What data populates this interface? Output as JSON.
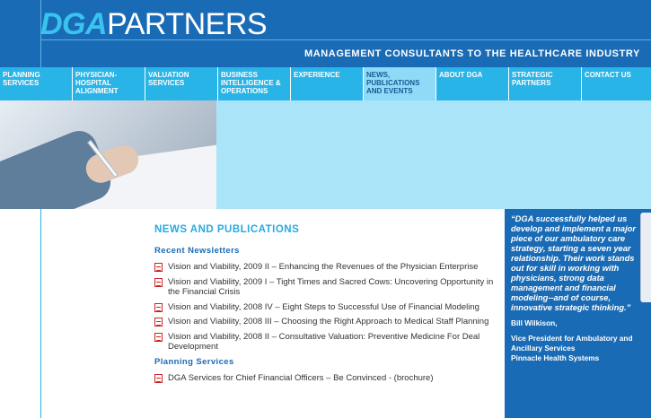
{
  "header": {
    "logo_dga": "DGA",
    "logo_partners": "PARTNERS",
    "tagline": "MANAGEMENT CONSULTANTS TO THE HEALTHCARE INDUSTRY"
  },
  "nav": {
    "items": [
      {
        "label": "PLANNING SERVICES"
      },
      {
        "label": "PHYSICIAN-HOSPITAL ALIGNMENT"
      },
      {
        "label": "VALUATION SERVICES"
      },
      {
        "label": "BUSINESS INTELLIGENCE & OPERATIONS"
      },
      {
        "label": "EXPERIENCE"
      },
      {
        "label": "NEWS, PUBLICATIONS AND EVENTS"
      },
      {
        "label": "ABOUT DGA"
      },
      {
        "label": "STRATEGIC PARTNERS"
      },
      {
        "label": "CONTACT US"
      }
    ]
  },
  "main": {
    "title": "NEWS AND PUBLICATIONS",
    "sections": [
      {
        "title": "Recent Newsletters",
        "items": [
          {
            "text": "Vision and Viability, 2009 II – Enhancing the Revenues of the Physician Enterprise"
          },
          {
            "text": "Vision and Viability, 2009 I – Tight Times and Sacred Cows: Uncovering Opportunity in the Financial Crisis"
          },
          {
            "text": "Vision and Viability, 2008 IV – Eight Steps to Successful Use of Financial Modeling"
          },
          {
            "text": "Vision and Viability, 2008 III – Choosing the Right Approach to Medical Staff Planning"
          },
          {
            "text": "Vision and Viability, 2008 II – Consultative Valuation: Preventive Medicine For Deal Development"
          }
        ]
      },
      {
        "title": "Planning Services",
        "items": [
          {
            "text": "DGA Services for Chief Financial Officers – Be Convinced - (brochure)"
          }
        ]
      }
    ]
  },
  "quote": {
    "text": "“DGA successfully helped us develop and implement a major piece of our ambulatory care strategy, starting a seven year relationship. Their work stands out for skill in working with physicians, strong data management and financial modeling--and of course, innovative strategic thinking.”",
    "name": "Bill Wilkison,",
    "role": "Vice President for Ambulatory and Ancillary Services",
    "org": "Pinnacle Health Systems"
  },
  "icons": {
    "pdf": "pdf-icon"
  },
  "colors": {
    "brand_blue": "#1a6bb5",
    "accent_cyan": "#29b4e8",
    "hero_bg": "#a9e4f8"
  }
}
